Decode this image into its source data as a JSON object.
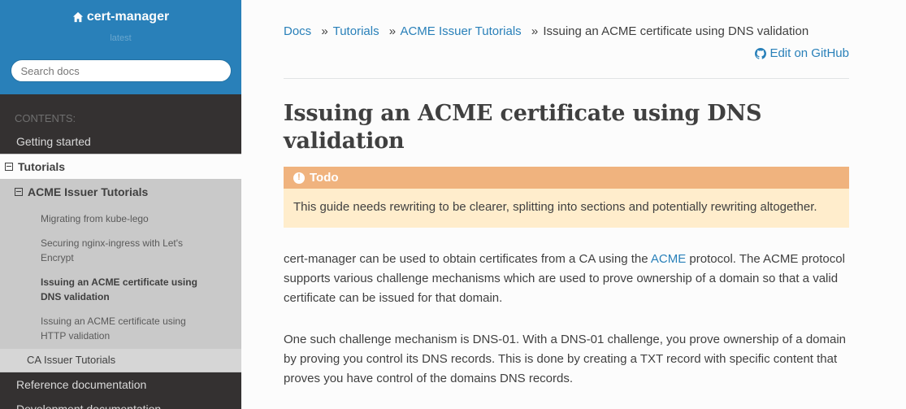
{
  "sidebar": {
    "brand": "cert-manager",
    "version": "latest",
    "search_placeholder": "Search docs",
    "caption": "CONTENTS:",
    "items": {
      "getting_started": "Getting started",
      "tutorials": "Tutorials",
      "acme_issuer_tutorials": "ACME Issuer Tutorials",
      "migrating": "Migrating from kube-lego",
      "securing_nginx": "Securing nginx-ingress with Let's Encrypt",
      "issuing_dns": "Issuing an ACME certificate using DNS validation",
      "issuing_http": "Issuing an ACME certificate using HTTP validation",
      "ca_issuer_tutorials": "CA Issuer Tutorials",
      "reference": "Reference documentation",
      "development": "Development documentation"
    }
  },
  "breadcrumbs": {
    "docs": "Docs",
    "tutorials": "Tutorials",
    "acme": "ACME Issuer Tutorials",
    "current": "Issuing an ACME certificate using DNS validation",
    "separator": "»"
  },
  "edit_link": "Edit on GitHub",
  "title": "Issuing an ACME certificate using DNS validation",
  "admonition": {
    "title": "Todo",
    "icon": "!",
    "body": "This guide needs rewriting to be clearer, splitting into sections and potentially rewriting altogether."
  },
  "paragraph1": {
    "before": "cert-manager can be used to obtain certificates from a CA using the ",
    "link": "ACME",
    "after": " protocol. The ACME protocol supports various challenge mechanisms which are used to prove ownership of a domain so that a valid certificate can be issued for that domain."
  },
  "paragraph2": "One such challenge mechanism is DNS-01. With a DNS-01 challenge, you prove ownership of a domain by proving you control its DNS records. This is done by creating a TXT record with specific content that proves you have control of the domains DNS records.",
  "colors": {
    "accent": "#2980b9",
    "sidebar_bg": "#343131",
    "admonition_title": "#f0b37e",
    "admonition_bg": "#ffedcc"
  }
}
